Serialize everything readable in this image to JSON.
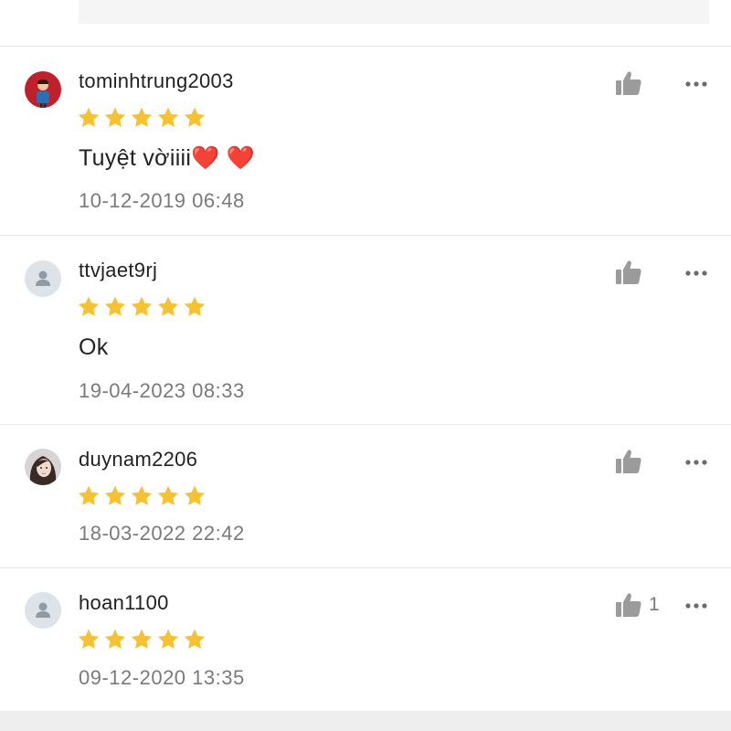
{
  "reviews": [
    {
      "username": "tominhtrung2003",
      "rating": 5,
      "comment": "Tuyệt vờiiii❤️ ❤️",
      "timestamp": "10-12-2019 06:48",
      "avatar": "profile-photo",
      "likes": ""
    },
    {
      "username": "ttvjaet9rj",
      "rating": 5,
      "comment": "Ok",
      "timestamp": "19-04-2023 08:33",
      "avatar": "default-user-icon",
      "likes": ""
    },
    {
      "username": "duynam2206",
      "rating": 5,
      "comment": "",
      "timestamp": "18-03-2022 22:42",
      "avatar": "profile-photo",
      "likes": ""
    },
    {
      "username": "hoan1100",
      "rating": 5,
      "comment": "",
      "timestamp": "09-12-2020 13:35",
      "avatar": "default-user-icon",
      "likes": "1"
    }
  ],
  "colors": {
    "star": "#f6c232",
    "icon_gray": "#9b9b9b",
    "divider": "#e6e6e6",
    "text": "#222222",
    "muted_text": "#7a7a7a"
  }
}
